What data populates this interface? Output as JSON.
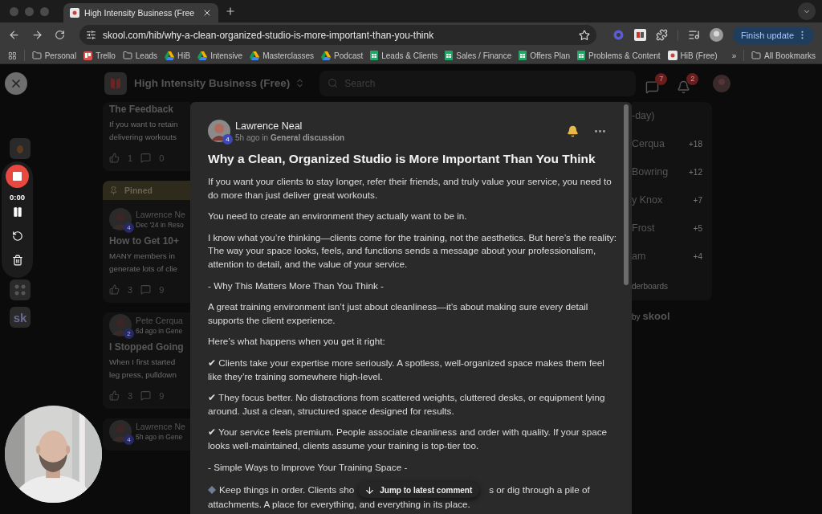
{
  "browser": {
    "tab": {
      "title": "High Intensity Business (Free"
    },
    "url": "skool.com/hib/why-a-clean-organized-studio-is-more-important-than-you-think",
    "update_button": "Finish update",
    "bookmarks": [
      {
        "kind": "folder",
        "label": "Personal"
      },
      {
        "kind": "trello",
        "label": "Trello"
      },
      {
        "kind": "folder",
        "label": "Leads"
      },
      {
        "kind": "drive",
        "label": "HiB"
      },
      {
        "kind": "drive",
        "label": "Intensive"
      },
      {
        "kind": "drive",
        "label": "Masterclasses"
      },
      {
        "kind": "drive",
        "label": "Podcast"
      },
      {
        "kind": "sheets",
        "label": "Leads & Clients"
      },
      {
        "kind": "sheets",
        "label": "Sales / Finance"
      },
      {
        "kind": "sheets",
        "label": "Offers Plan"
      },
      {
        "kind": "sheets",
        "label": "Problems & Content"
      },
      {
        "kind": "skool",
        "label": "HiB (Free)"
      }
    ],
    "more_bookmarks": "»",
    "all_bookmarks": "All Bookmarks"
  },
  "community": {
    "name": "High Intensity Business (Free)",
    "search": {
      "placeholder": "Search"
    },
    "chat_count": "7",
    "notification_count": "2"
  },
  "feed": [
    {
      "title": "The Feedback",
      "excerpt": [
        "If you want to retain",
        "delivering workouts"
      ],
      "likes": "1",
      "comments": "0"
    },
    {
      "pinned_label": "Pinned",
      "author": "Lawrence Ne",
      "level": "4",
      "meta": "Dec '24 in Reso",
      "title": "How to Get 10+",
      "excerpt": [
        "MANY members in",
        "generate lots of clie"
      ],
      "likes": "3",
      "comments": "9"
    },
    {
      "author": "Pete Cerqua",
      "level": "2",
      "meta": "6d ago in Gene",
      "title": "I Stopped Going",
      "excerpt": [
        "When I first started",
        "leg press, pulldown"
      ],
      "likes": "3",
      "comments": "9"
    },
    {
      "author": "Lawrence Ne",
      "level": "4",
      "meta": "5h ago in Gene"
    }
  ],
  "leaderboard": {
    "title": "-day)",
    "rows": [
      {
        "name": "Cerqua",
        "points": "+18"
      },
      {
        "name": "Bowring",
        "points": "+12"
      },
      {
        "name": "y Knox",
        "points": "+7"
      },
      {
        "name": "Frost",
        "points": "+5"
      },
      {
        "name": "am",
        "points": "+4"
      }
    ],
    "footer": "derboards"
  },
  "powered_by": {
    "prefix": "by",
    "brand": "skool"
  },
  "post": {
    "author": "Lawrence Neal",
    "level": "4",
    "meta": "5h ago in **General discussion**",
    "subscribed": true,
    "title": "Why a Clean, Organized Studio is More Important Than You Think",
    "body": [
      {
        "kind": "text",
        "text": "If you want your clients to stay longer, refer their friends, and truly value your service, you need to do more than just deliver great workouts."
      },
      {
        "kind": "text",
        "text": "You need to create an environment they actually want to be in."
      },
      {
        "kind": "text",
        "text": "I know what you’re thinking—clients come for the training, not the aesthetics. But here’s the reality: The way your space looks, feels, and functions sends a message about your professionalism, attention to detail, and the value of your service."
      },
      {
        "kind": "text",
        "text": "- Why This Matters More Than You Think -"
      },
      {
        "kind": "text",
        "text": "A great training environment isn’t just about cleanliness—it’s about making sure every detail supports the client experience."
      },
      {
        "kind": "text",
        "text": "Here’s what happens when you get it right:"
      },
      {
        "kind": "text",
        "text": "✔ Clients take your expertise more seriously. A spotless, well-organized space makes them feel like they’re training somewhere high-level."
      },
      {
        "kind": "text",
        "text": "✔ They focus better. No distractions from scattered weights, cluttered desks, or equipment lying around. Just a clean, structured space designed for results."
      },
      {
        "kind": "text",
        "text": "✔ Your service feels premium. People associate cleanliness and order with quality. If your space looks well-maintained, clients assume your training is top-tier too."
      },
      {
        "kind": "text",
        "text": "- Simple Ways to Improve Your Training Space -"
      },
      {
        "kind": "diamond",
        "parts": [
          "Keep things in order. Clients sho",
          "s or dig through a pile of"
        ],
        "continuation": "attachments. A place for everything, and everything in its place."
      }
    ]
  },
  "jump_button": "Jump to latest comment",
  "recorder": {
    "time": "0:00"
  },
  "side_app_label": "sk"
}
